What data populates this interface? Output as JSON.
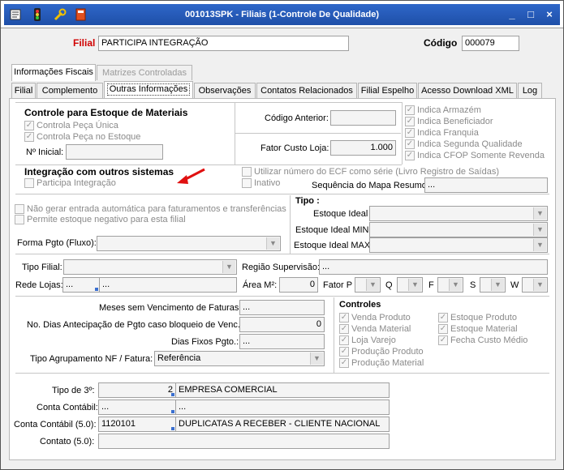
{
  "window": {
    "title": "001013SPK - Filiais (1-Controle De Qualidade)",
    "icons": [
      "edit-icon",
      "traffic-light-icon",
      "wrench-icon",
      "report-icon"
    ],
    "buttons": [
      "minimize",
      "maximize",
      "close"
    ]
  },
  "header": {
    "filial_label": "Filial",
    "filial_value": "PARTICIPA INTEGRAÇÃO",
    "codigo_label": "Código",
    "codigo_value": "000079"
  },
  "outer_tabs": [
    "Informações Fiscais",
    "Matrizes Controladas"
  ],
  "inner_tabs": [
    "Filial",
    "Complemento",
    "Outras Informações",
    "Observações",
    "Contatos Relacionados",
    "Filial Espelho",
    "Acesso Download XML",
    "Log"
  ],
  "estoque": {
    "heading": "Controle para Estoque de Materiais",
    "controla_peca_unica": "Controla Peça Única",
    "controla_peca_estoque": "Controla Peça no Estoque",
    "n_inicial_label": "Nº Inicial:",
    "n_inicial_value": ""
  },
  "codigo_anterior": {
    "label": "Código Anterior:",
    "value": ""
  },
  "fator_custo": {
    "label": "Fator Custo Loja:",
    "value": "1.000"
  },
  "indica": [
    "Indica Armazém",
    "Indica Beneficiador",
    "Indica Franquia",
    "Indica Segunda Qualidade",
    "Indica CFOP Somente Revenda"
  ],
  "integracao": {
    "heading": "Integração com outros sistemas",
    "participa": "Participa Integração",
    "utilizar_ecf": "Utilizar número do ECF como série (Livro Registro de Saídas)",
    "inativo": "Inativo",
    "sequencia_label": "Sequência do Mapa Resumo:",
    "sequencia_value": "..."
  },
  "estoque_opts": {
    "nao_gerar": "Não gerar entrada automática para faturamentos e transferências",
    "permite_negativo": "Permite estoque negativo para esta filial"
  },
  "tipo": {
    "heading": "Tipo :",
    "estoque_ideal": "Estoque Ideal",
    "estoque_ideal_min": "Estoque Ideal MIN",
    "estoque_ideal_max": "Estoque Ideal MAX"
  },
  "forma_pgto": {
    "label": "Forma Pgto (Fluxo):",
    "value": ""
  },
  "tipo_filial": {
    "label": "Tipo Filial:",
    "value": ""
  },
  "regiao": {
    "label": "Região Supervisão:",
    "value": "..."
  },
  "rede_lojas": {
    "label": "Rede Lojas:",
    "code": "...",
    "value": "..."
  },
  "area": {
    "label": "Área M²:",
    "value": "0"
  },
  "fator_letras": [
    "Fator P",
    "Q",
    "F",
    "S",
    "W"
  ],
  "financeiro": {
    "meses_label": "Meses sem Vencimento de Faturas:",
    "meses_value": "...",
    "dias_antecipacao_label": "No. Dias Antecipação de Pgto caso bloqueio de Venc.:",
    "dias_antecipacao_value": "0",
    "dias_fixos_label": "Dias Fixos Pgto.:",
    "dias_fixos_value": "...",
    "agrupamento_label": "Tipo Agrupamento NF / Fatura:",
    "agrupamento_value": "Referência"
  },
  "controles": {
    "heading": "Controles",
    "col1": [
      "Venda Produto",
      "Venda Material",
      "Loja Varejo",
      "Produção Produto",
      "Produção Material"
    ],
    "col2": [
      "Estoque Produto",
      "Estoque Material",
      "Fecha Custo Médio"
    ]
  },
  "contabil": {
    "tipo3_label": "Tipo de 3º:",
    "tipo3_code": "2",
    "tipo3_value": "EMPRESA COMERCIAL",
    "conta_label": "Conta Contábil:",
    "conta_code": "...",
    "conta_value": "...",
    "conta5_label": "Conta Contábil (5.0):",
    "conta5_code": "1120101",
    "conta5_value": "DUPLICATAS A RECEBER - CLIENTE NACIONAL",
    "contato5_label": "Contato (5.0):",
    "contato5_value": ""
  },
  "colors": {
    "title_blue": "#1e4fa8",
    "filial_red": "#d00000",
    "arrow_red": "#e01010"
  }
}
